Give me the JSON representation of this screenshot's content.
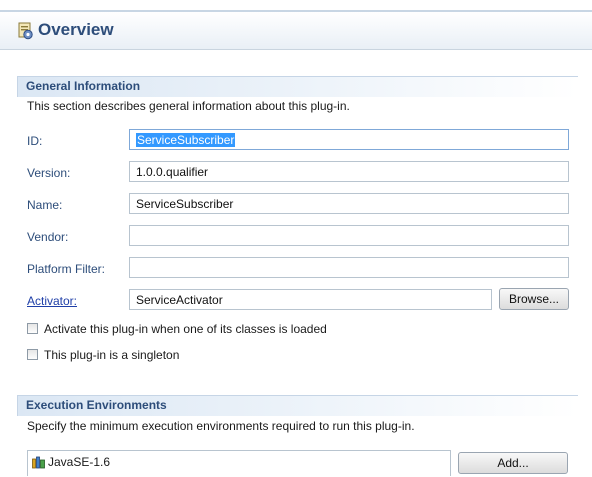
{
  "header": {
    "title": "Overview",
    "icon": "plugin-overview-icon"
  },
  "general": {
    "title": "General Information",
    "description": "This section describes general information about this plug-in.",
    "fields": {
      "id": {
        "label": "ID:",
        "value": "ServiceSubscriber"
      },
      "version": {
        "label": "Version:",
        "value": "1.0.0.qualifier"
      },
      "name": {
        "label": "Name:",
        "value": "ServiceSubscriber"
      },
      "vendor": {
        "label": "Vendor:",
        "value": ""
      },
      "platform_filter": {
        "label": "Platform Filter:",
        "value": ""
      },
      "activator": {
        "label": "Activator:",
        "value": "ServiceActivator"
      }
    },
    "browse_label": "Browse...",
    "checkboxes": {
      "activate_on_load": {
        "label": "Activate this plug-in when one of its classes is loaded",
        "checked": false
      },
      "singleton": {
        "label": "This plug-in is a singleton",
        "checked": false
      }
    }
  },
  "execution": {
    "title": "Execution Environments",
    "description": "Specify the minimum execution environments required to run this plug-in.",
    "environments": [
      {
        "label": "JavaSE-1.6",
        "icon": "library-icon"
      }
    ],
    "add_label": "Add..."
  },
  "colors": {
    "section_title": "#2d4d7a",
    "selection": "#3399ff",
    "link": "#1f3fa8"
  }
}
